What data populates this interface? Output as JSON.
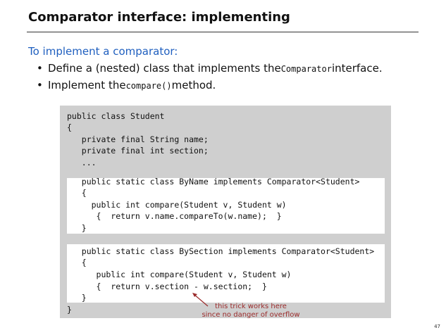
{
  "slide": {
    "title": "Comparator interface:  implementing",
    "page_number": "47"
  },
  "intro": {
    "heading": "To implement a comparator:"
  },
  "bullets": [
    {
      "before": "Define a (nested) class that implements the ",
      "code": "Comparator",
      "after": " interface."
    },
    {
      "before": "Implement the ",
      "code": "compare()",
      "after": " method."
    }
  ],
  "code": {
    "lines": [
      "public class Student",
      "{",
      "   private final String name;",
      "   private final int section;",
      "   ...",
      "   public static class ByName implements Comparator<Student>",
      "   {",
      "     public int compare(Student v, Student w)",
      "      {  return v.name.compareTo(w.name);  }",
      "   }",
      "   public static class BySection implements Comparator<Student>",
      "   {",
      "      public int compare(Student v, Student w)",
      "      {  return v.section - w.section;  }",
      "   }",
      "}"
    ]
  },
  "annotation": {
    "line1": "this trick works here",
    "line2": "since no danger of overflow",
    "color": "#9b2c2c"
  },
  "colors": {
    "heading_blue": "#1f5fbf",
    "code_background": "#cfcfcf",
    "highlight_box": "#ffffff"
  }
}
